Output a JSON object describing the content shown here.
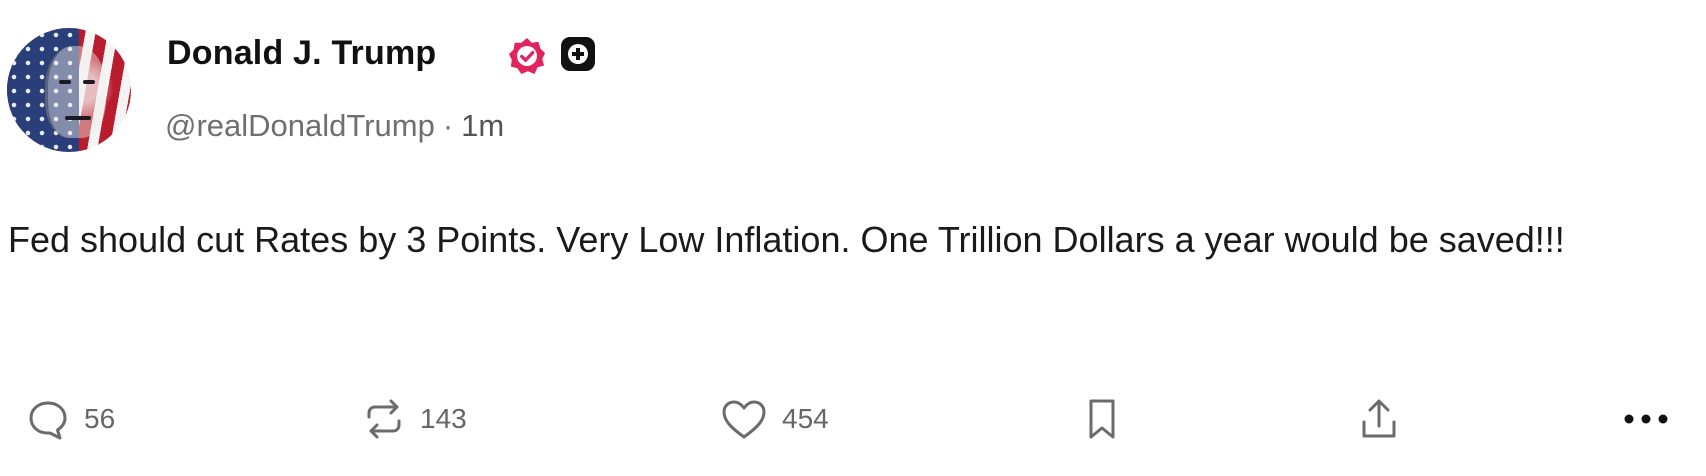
{
  "post": {
    "author": {
      "name": "Donald J. Trump",
      "handle": "@realDonaldTrump",
      "separator": "·",
      "time": "1m",
      "avatar_icon": "avatar-portrait-flag",
      "verified_icon": "verified-badge-icon",
      "plus_icon": "plus-badge-icon"
    },
    "text": "Fed should cut Rates by 3 Points. Very Low Inflation. One Trillion Dollars a year would be saved!!!",
    "actions": {
      "reply_count": "56",
      "repost_count": "143",
      "like_count": "454"
    }
  },
  "colors": {
    "verified_badge": "#e0245e",
    "text_primary": "#111111",
    "text_secondary": "#6f6f6f",
    "icon": "#6b6b6b"
  }
}
